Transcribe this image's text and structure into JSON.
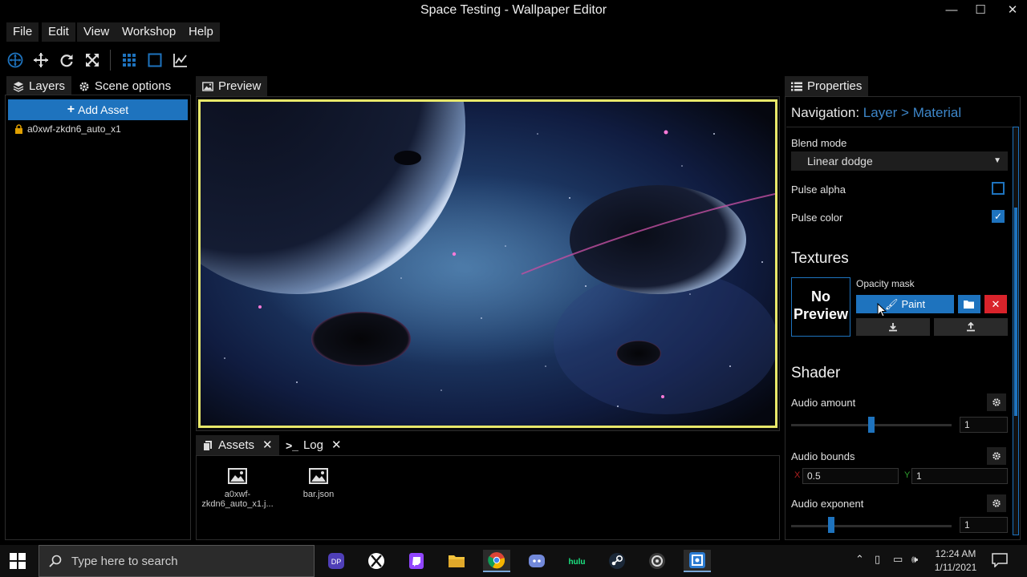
{
  "window": {
    "title": "Space Testing - Wallpaper Editor",
    "minimize": "—",
    "maximize": "☐",
    "close": "✕"
  },
  "menu": [
    "File",
    "Edit",
    "View",
    "Workshop",
    "Help"
  ],
  "left_tabs": {
    "layers": "Layers",
    "scene_options": "Scene options"
  },
  "add_asset_label": "Add Asset",
  "layers": [
    {
      "name": "a0xwf-zkdn6_auto_x1"
    }
  ],
  "preview_tab": "Preview",
  "bottom_tabs": {
    "assets": "Assets",
    "log": "Log"
  },
  "assets": [
    {
      "name_line1": "a0xwf-",
      "name_line2": "zkdn6_auto_x1.j..."
    },
    {
      "name_line1": "bar.json",
      "name_line2": ""
    }
  ],
  "properties": {
    "tab": "Properties",
    "nav_label": "Navigation:",
    "nav_path": "Layer > Material",
    "blend_mode_label": "Blend mode",
    "blend_mode_value": "Linear dodge",
    "pulse_alpha_label": "Pulse alpha",
    "pulse_alpha_checked": false,
    "pulse_color_label": "Pulse color",
    "pulse_color_checked": true,
    "textures_title": "Textures",
    "no_preview_line1": "No",
    "no_preview_line2": "Preview",
    "opacity_mask_label": "Opacity mask",
    "paint_label": "Paint",
    "shader_title": "Shader",
    "audio_amount_label": "Audio amount",
    "audio_amount_value": "1",
    "audio_amount_slider": 0.5,
    "audio_bounds_label": "Audio bounds",
    "audio_bounds_x_label": "X",
    "audio_bounds_x": "0.5",
    "audio_bounds_y_label": "Y",
    "audio_bounds_y": "1",
    "audio_exponent_label": "Audio exponent",
    "audio_exponent_value": "1",
    "audio_exponent_slider": 0.25
  },
  "taskbar": {
    "search_placeholder": "Type here to search",
    "time": "12:24 AM",
    "date": "1/11/2021"
  },
  "colors": {
    "accent": "#1e73be",
    "preview_border": "#e8e86a",
    "delete": "#d9232b"
  }
}
